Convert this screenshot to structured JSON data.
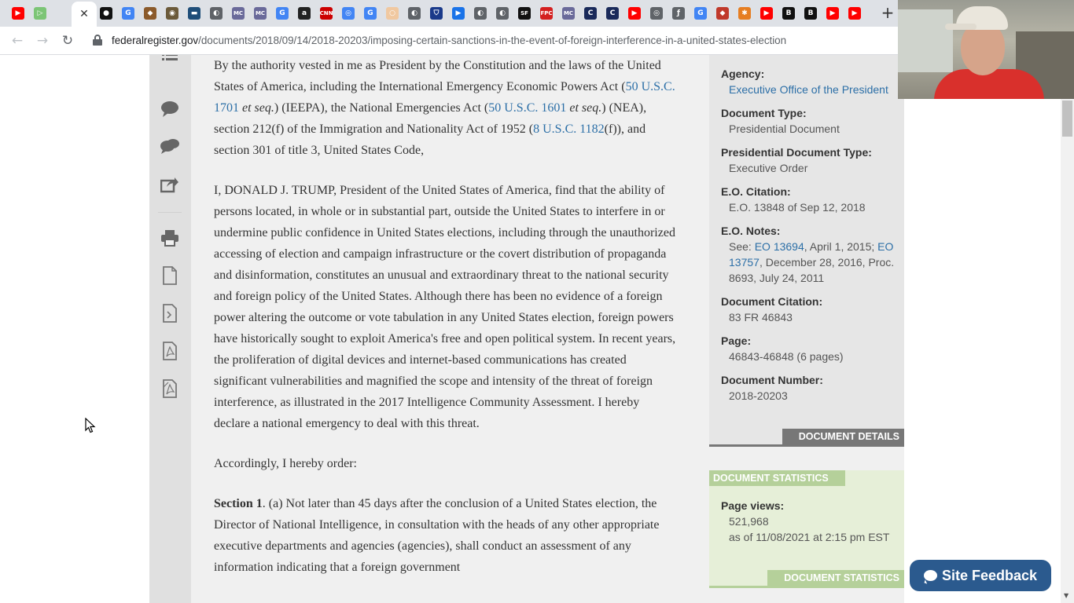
{
  "browser": {
    "tabs": [
      {
        "icon": "youtube-icon",
        "color": "#ff0000",
        "glyph": "▶"
      },
      {
        "icon": "play-circle-icon",
        "color": "#7cc576",
        "glyph": "▷"
      },
      {
        "icon": "blank-tab-icon",
        "color": "#dee1e6",
        "glyph": ""
      },
      {
        "icon": "close-icon",
        "color": "#ffffff",
        "glyph": "✕",
        "active": true
      },
      {
        "icon": "black-circle-icon",
        "color": "#111111",
        "glyph": "●"
      },
      {
        "icon": "google-icon",
        "color": "#4285f4",
        "glyph": "G"
      },
      {
        "icon": "badge-icon",
        "color": "#8b5a2b",
        "glyph": "◆"
      },
      {
        "icon": "seal-icon",
        "color": "#6b5a3a",
        "glyph": "◉"
      },
      {
        "icon": "news-icon",
        "color": "#1f4e79",
        "glyph": "▬"
      },
      {
        "icon": "globe-icon",
        "color": "#5f6368",
        "glyph": "◐"
      },
      {
        "icon": "mc-icon",
        "color": "#6a6a9a",
        "glyph": "MC"
      },
      {
        "icon": "mc-icon",
        "color": "#6a6a9a",
        "glyph": "MC"
      },
      {
        "icon": "google-icon",
        "color": "#4285f4",
        "glyph": "G"
      },
      {
        "icon": "amazon-icon",
        "color": "#222222",
        "glyph": "a"
      },
      {
        "icon": "cnn-icon",
        "color": "#cc0000",
        "glyph": "CNN"
      },
      {
        "icon": "chrome-icon",
        "color": "#4285f4",
        "glyph": "◎"
      },
      {
        "icon": "google-icon",
        "color": "#4285f4",
        "glyph": "G"
      },
      {
        "icon": "circle-icon",
        "color": "#f0c8a0",
        "glyph": "○"
      },
      {
        "icon": "globe-icon",
        "color": "#5f6368",
        "glyph": "◐"
      },
      {
        "icon": "shield-icon",
        "color": "#1a3a8a",
        "glyph": "⛉"
      },
      {
        "icon": "play-icon",
        "color": "#1a73e8",
        "glyph": "▶"
      },
      {
        "icon": "globe-icon",
        "color": "#5f6368",
        "glyph": "◐"
      },
      {
        "icon": "globe-icon",
        "color": "#5f6368",
        "glyph": "◐"
      },
      {
        "icon": "sf-icon",
        "color": "#111111",
        "glyph": "SF"
      },
      {
        "icon": "fpc-icon",
        "color": "#d42020",
        "glyph": "FPC"
      },
      {
        "icon": "mc-icon",
        "color": "#6a6a9a",
        "glyph": "MC"
      },
      {
        "icon": "c-icon",
        "color": "#1a2a5a",
        "glyph": "C"
      },
      {
        "icon": "c-icon",
        "color": "#1a2a5a",
        "glyph": "C"
      },
      {
        "icon": "youtube-icon",
        "color": "#ff0000",
        "glyph": "▶"
      },
      {
        "icon": "chrome-icon",
        "color": "#5f6368",
        "glyph": "◎"
      },
      {
        "icon": "script-icon",
        "color": "#5f6368",
        "glyph": "ƒ"
      },
      {
        "icon": "google-icon",
        "color": "#4285f4",
        "glyph": "G"
      },
      {
        "icon": "red-badge-icon",
        "color": "#c0392b",
        "glyph": "◆"
      },
      {
        "icon": "colorful-icon",
        "color": "#e67e22",
        "glyph": "✱"
      },
      {
        "icon": "youtube-icon",
        "color": "#ff0000",
        "glyph": "▶"
      },
      {
        "icon": "b-icon",
        "color": "#111111",
        "glyph": "B"
      },
      {
        "icon": "b-icon",
        "color": "#111111",
        "glyph": "B"
      },
      {
        "icon": "youtube-icon",
        "color": "#ff0000",
        "glyph": "▶"
      },
      {
        "icon": "youtube-icon",
        "color": "#ff0000",
        "glyph": "▶"
      }
    ],
    "new_tab": "+",
    "url_host": "federalregister.gov",
    "url_path": "/documents/2018/09/14/2018-20203/imposing-certain-sanctions-in-the-event-of-foreign-interference-in-a-united-states-election"
  },
  "article": {
    "p1": {
      "t1": "By the authority vested in me as President by the Constitution and the laws of the United States of America, including the International Emergency Economic Powers Act (",
      "l1": "50 U.S.C. 1701",
      "e1": " et seq.",
      "t2": ") (IEEPA), the National Emergencies Act (",
      "l2": "50 U.S.C. 1601",
      "e2": " et seq.",
      "t3": ") (NEA), section 212(f) of the Immigration and Nationality Act of 1952 (",
      "l3": "8 U.S.C. 1182",
      "t4": "(f)), and section 301 of title 3, United States Code,"
    },
    "p2": "I, DONALD J. TRUMP, President of the United States of America, find that the ability of persons located, in whole or in substantial part, outside the United States to interfere in or undermine public confidence in United States elections, including through the unauthorized accessing of election and campaign infrastructure or the covert distribution of propaganda and disinformation, constitutes an unusual and extraordinary threat to the national security and foreign policy of the United States. Although there has been no evidence of a foreign power altering the outcome or vote tabulation in any United States election, foreign powers have historically sought to exploit America's free and open political system. In recent years, the proliferation of digital devices and internet-based communications has created significant vulnerabilities and magnified the scope and intensity of the threat of foreign interference, as illustrated in the 2017 Intelligence Community Assessment. I hereby declare a national emergency to deal with this threat.",
    "p3": "Accordingly, I hereby order:",
    "p4_heading": "Section 1",
    "p4": ". (a) Not later than 45 days after the conclusion of a United States election, the Director of National Intelligence, in consultation with the heads of any other appropriate executive departments and agencies (agencies), shall conduct an assessment of any information indicating that a foreign government"
  },
  "details": {
    "agency_label": "Agency:",
    "agency_value": "Executive Office of the President",
    "doctype_label": "Document Type:",
    "doctype_value": "Presidential Document",
    "presdoctype_label": "Presidential Document Type:",
    "presdoctype_value": "Executive Order",
    "eo_citation_label": "E.O. Citation:",
    "eo_citation_value": "E.O. 13848 of Sep 12, 2018",
    "eo_notes_label": "E.O. Notes:",
    "eo_notes_see": "See: ",
    "eo_notes_link1": "EO 13694",
    "eo_notes_t1": ", April 1, 2015; ",
    "eo_notes_link2": "EO 13757",
    "eo_notes_t2": ", December 28, 2016, Proc. 8693, July 24, 2011",
    "doc_citation_label": "Document Citation:",
    "doc_citation_value": "83 FR 46843",
    "page_label": "Page:",
    "page_value": "46843-46848 (6 pages)",
    "doc_number_label": "Document Number:",
    "doc_number_value": "2018-20203",
    "tab_label": "DOCUMENT DETAILS"
  },
  "statistics": {
    "tab_label": "DOCUMENT STATISTICS",
    "pageviews_label": "Page views:",
    "pageviews_value": "521,968",
    "pageviews_asof": "as of 11/08/2021 at 2:15 pm EST",
    "bottom_tab_label": "DOCUMENT STATISTICS"
  },
  "feedback": {
    "label": "Site Feedback"
  },
  "sidebar_icons": [
    "list-icon",
    "comment-icon",
    "comments-icon",
    "share-icon",
    "print-icon",
    "document-icon",
    "xml-icon",
    "pdf-icon",
    "public-inspection-pdf-icon"
  ]
}
